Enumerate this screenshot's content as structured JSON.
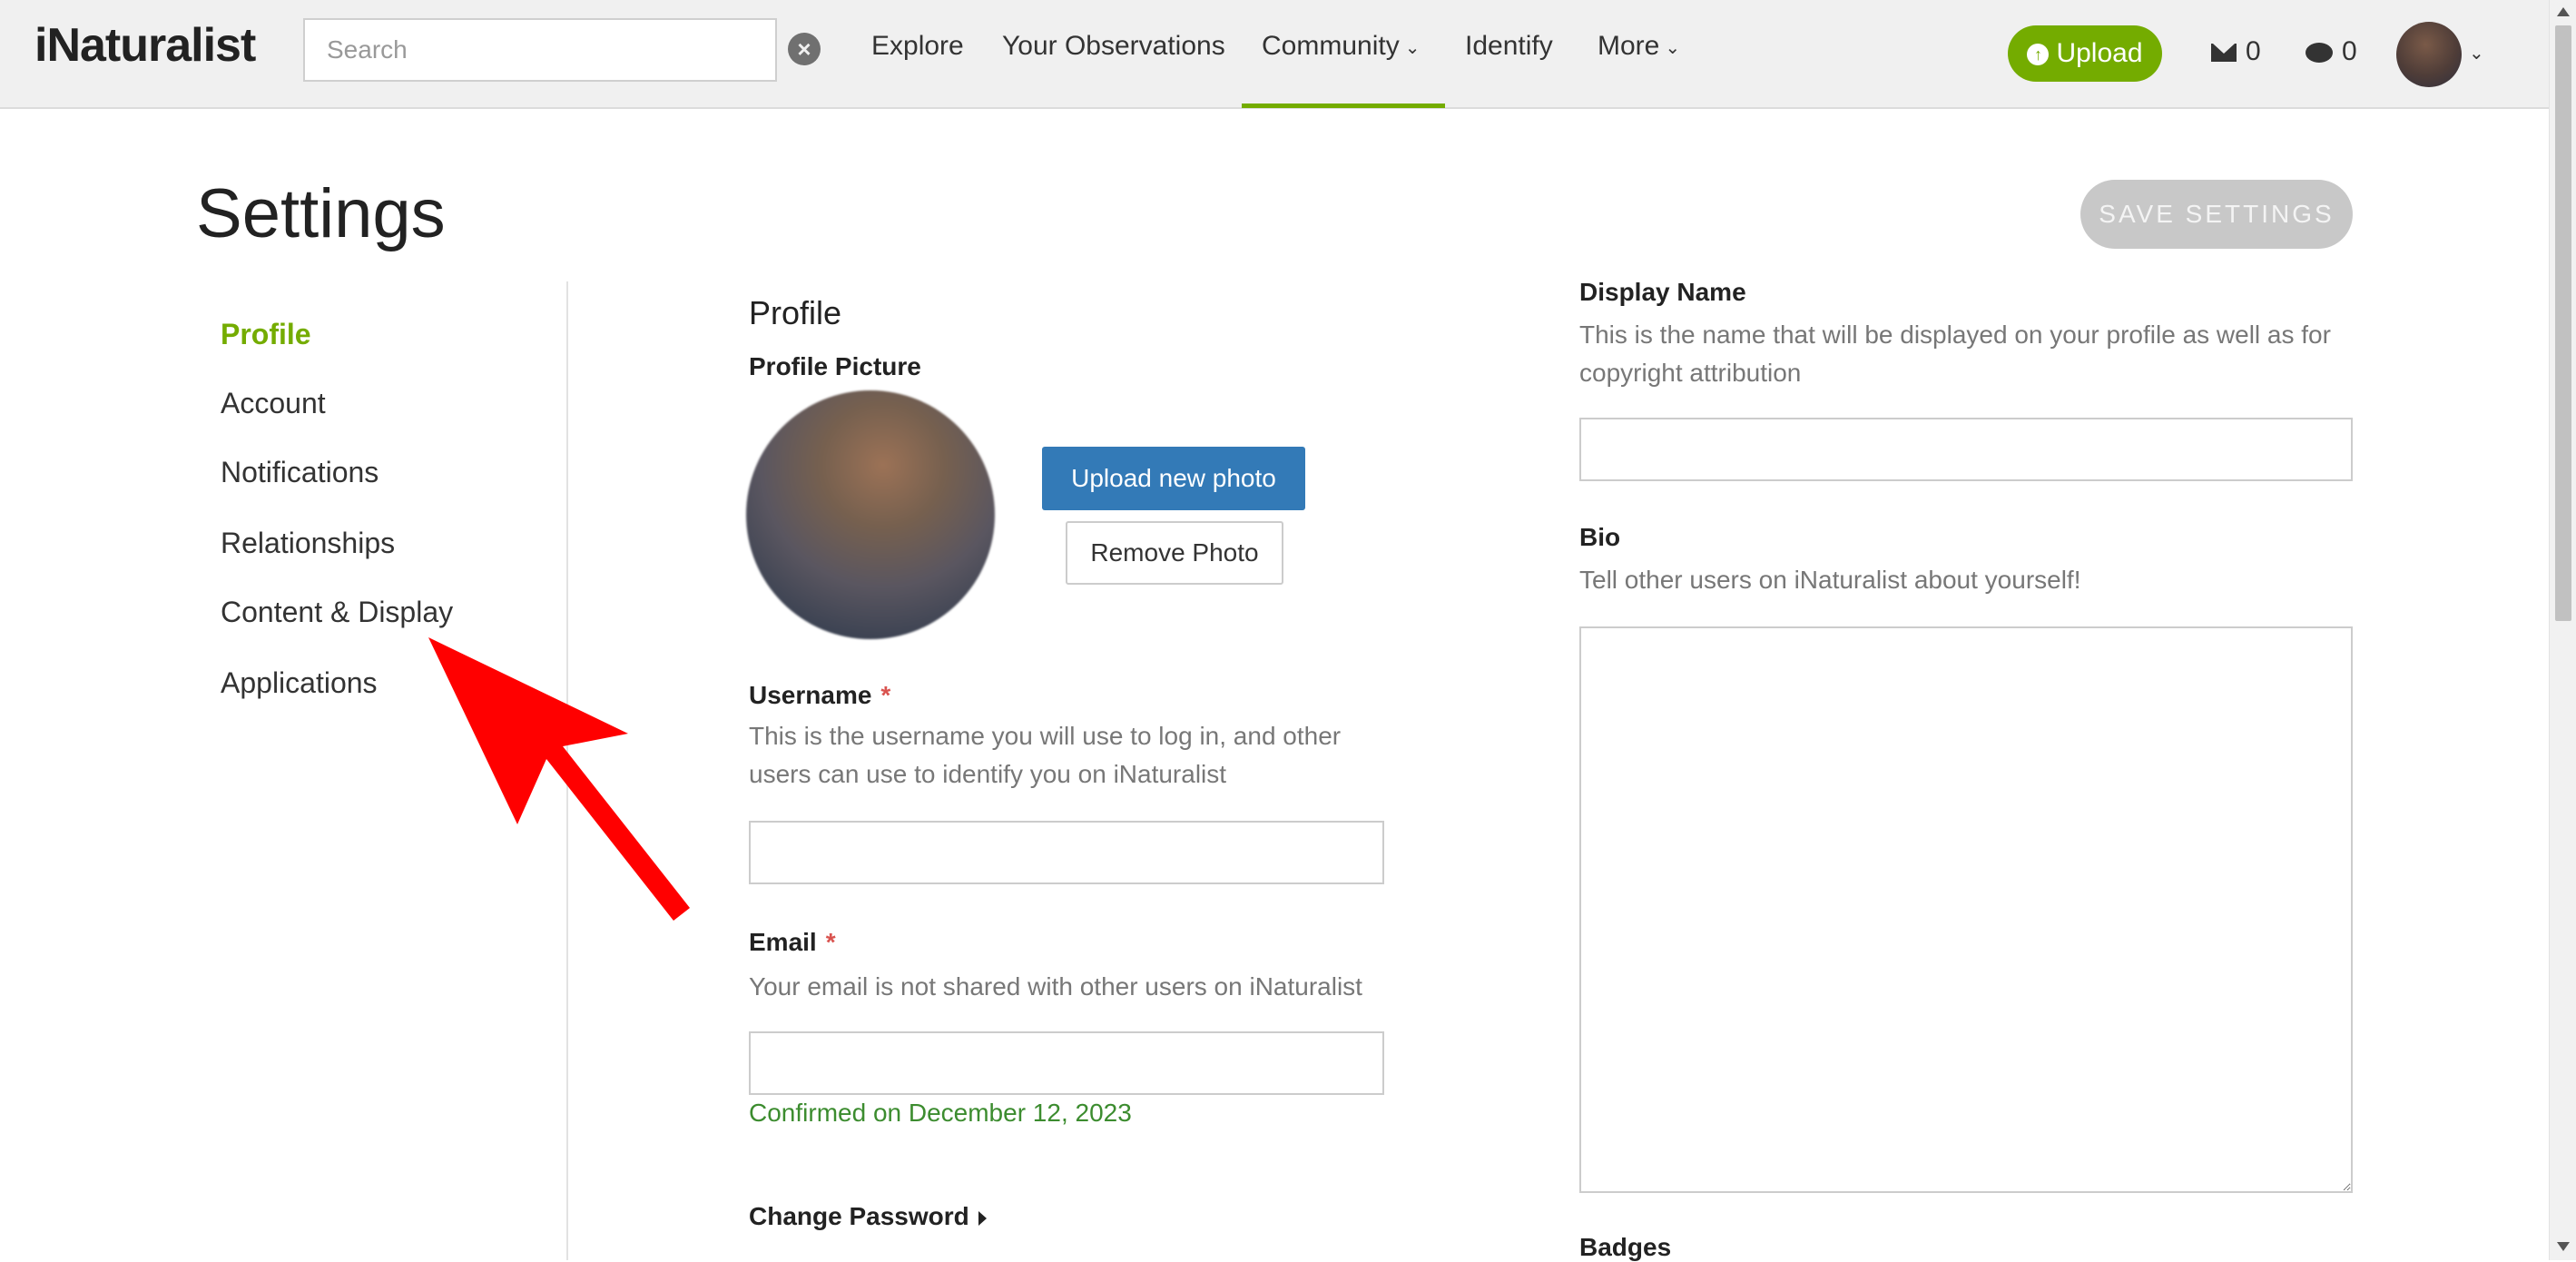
{
  "nav": {
    "logo": "iNaturalist",
    "search_placeholder": "Search",
    "items": [
      {
        "label": "Explore"
      },
      {
        "label": "Your Observations"
      },
      {
        "label": "Community"
      },
      {
        "label": "Identify"
      },
      {
        "label": "More"
      }
    ],
    "active_item": "Community",
    "upload_label": "Upload",
    "messages_count": "0",
    "notifications_count": "0"
  },
  "page": {
    "title": "Settings",
    "save_label": "SAVE SETTINGS"
  },
  "sidebar": {
    "items": [
      {
        "label": "Profile",
        "active": true
      },
      {
        "label": "Account"
      },
      {
        "label": "Notifications"
      },
      {
        "label": "Relationships"
      },
      {
        "label": "Content & Display"
      },
      {
        "label": "Applications"
      }
    ]
  },
  "profile": {
    "section_title": "Profile",
    "picture_label": "Profile Picture",
    "upload_photo_label": "Upload new photo",
    "remove_photo_label": "Remove Photo",
    "username_label": "Username",
    "username_required": "*",
    "username_help": "This is the username you will use to log in, and other users can use to identify you on iNaturalist",
    "username_value": "",
    "email_label": "Email",
    "email_required": "*",
    "email_help": "Your email is not shared with other users on iNaturalist",
    "email_value": "",
    "email_confirmed": "Confirmed on December 12, 2023",
    "change_password_label": "Change Password"
  },
  "right_column": {
    "display_name_label": "Display Name",
    "display_name_help": "This is the name that will be displayed on your profile as well as for copyright attribution",
    "display_name_value": "",
    "bio_label": "Bio",
    "bio_help": "Tell other users on iNaturalist about yourself!",
    "bio_value": "",
    "badges_label": "Badges"
  },
  "colors": {
    "brand_green": "#74ac00",
    "primary_blue": "#337ab7",
    "annotation_red": "#ff0000"
  }
}
